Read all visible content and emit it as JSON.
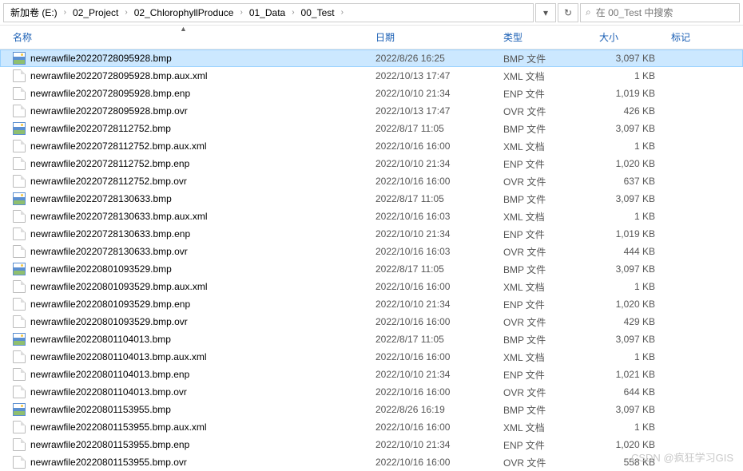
{
  "breadcrumb": [
    "新加卷 (E:)",
    "02_Project",
    "02_ChlorophyllProduce",
    "01_Data",
    "00_Test"
  ],
  "search": {
    "placeholder": "在 00_Test 中搜索"
  },
  "columns": {
    "name": "名称",
    "date": "日期",
    "type": "类型",
    "size": "大小",
    "tag": "标记"
  },
  "files": [
    {
      "name": "newrawfile20220728095928.bmp",
      "date": "2022/8/26 16:25",
      "type": "BMP 文件",
      "size": "3,097 KB",
      "icon": "bmp",
      "selected": true
    },
    {
      "name": "newrawfile20220728095928.bmp.aux.xml",
      "date": "2022/10/13 17:47",
      "type": "XML 文档",
      "size": "1 KB",
      "icon": "generic"
    },
    {
      "name": "newrawfile20220728095928.bmp.enp",
      "date": "2022/10/10 21:34",
      "type": "ENP 文件",
      "size": "1,019 KB",
      "icon": "generic"
    },
    {
      "name": "newrawfile20220728095928.bmp.ovr",
      "date": "2022/10/13 17:47",
      "type": "OVR 文件",
      "size": "426 KB",
      "icon": "generic"
    },
    {
      "name": "newrawfile20220728112752.bmp",
      "date": "2022/8/17 11:05",
      "type": "BMP 文件",
      "size": "3,097 KB",
      "icon": "bmp"
    },
    {
      "name": "newrawfile20220728112752.bmp.aux.xml",
      "date": "2022/10/16 16:00",
      "type": "XML 文档",
      "size": "1 KB",
      "icon": "generic"
    },
    {
      "name": "newrawfile20220728112752.bmp.enp",
      "date": "2022/10/10 21:34",
      "type": "ENP 文件",
      "size": "1,020 KB",
      "icon": "generic"
    },
    {
      "name": "newrawfile20220728112752.bmp.ovr",
      "date": "2022/10/16 16:00",
      "type": "OVR 文件",
      "size": "637 KB",
      "icon": "generic"
    },
    {
      "name": "newrawfile20220728130633.bmp",
      "date": "2022/8/17 11:05",
      "type": "BMP 文件",
      "size": "3,097 KB",
      "icon": "bmp"
    },
    {
      "name": "newrawfile20220728130633.bmp.aux.xml",
      "date": "2022/10/16 16:03",
      "type": "XML 文档",
      "size": "1 KB",
      "icon": "generic"
    },
    {
      "name": "newrawfile20220728130633.bmp.enp",
      "date": "2022/10/10 21:34",
      "type": "ENP 文件",
      "size": "1,019 KB",
      "icon": "generic"
    },
    {
      "name": "newrawfile20220728130633.bmp.ovr",
      "date": "2022/10/16 16:03",
      "type": "OVR 文件",
      "size": "444 KB",
      "icon": "generic"
    },
    {
      "name": "newrawfile20220801093529.bmp",
      "date": "2022/8/17 11:05",
      "type": "BMP 文件",
      "size": "3,097 KB",
      "icon": "bmp"
    },
    {
      "name": "newrawfile20220801093529.bmp.aux.xml",
      "date": "2022/10/16 16:00",
      "type": "XML 文档",
      "size": "1 KB",
      "icon": "generic"
    },
    {
      "name": "newrawfile20220801093529.bmp.enp",
      "date": "2022/10/10 21:34",
      "type": "ENP 文件",
      "size": "1,020 KB",
      "icon": "generic"
    },
    {
      "name": "newrawfile20220801093529.bmp.ovr",
      "date": "2022/10/16 16:00",
      "type": "OVR 文件",
      "size": "429 KB",
      "icon": "generic"
    },
    {
      "name": "newrawfile20220801104013.bmp",
      "date": "2022/8/17 11:05",
      "type": "BMP 文件",
      "size": "3,097 KB",
      "icon": "bmp"
    },
    {
      "name": "newrawfile20220801104013.bmp.aux.xml",
      "date": "2022/10/16 16:00",
      "type": "XML 文档",
      "size": "1 KB",
      "icon": "generic"
    },
    {
      "name": "newrawfile20220801104013.bmp.enp",
      "date": "2022/10/10 21:34",
      "type": "ENP 文件",
      "size": "1,021 KB",
      "icon": "generic"
    },
    {
      "name": "newrawfile20220801104013.bmp.ovr",
      "date": "2022/10/16 16:00",
      "type": "OVR 文件",
      "size": "644 KB",
      "icon": "generic"
    },
    {
      "name": "newrawfile20220801153955.bmp",
      "date": "2022/8/26 16:19",
      "type": "BMP 文件",
      "size": "3,097 KB",
      "icon": "bmp"
    },
    {
      "name": "newrawfile20220801153955.bmp.aux.xml",
      "date": "2022/10/16 16:00",
      "type": "XML 文档",
      "size": "1 KB",
      "icon": "generic"
    },
    {
      "name": "newrawfile20220801153955.bmp.enp",
      "date": "2022/10/10 21:34",
      "type": "ENP 文件",
      "size": "1,020 KB",
      "icon": "generic"
    },
    {
      "name": "newrawfile20220801153955.bmp.ovr",
      "date": "2022/10/16 16:00",
      "type": "OVR 文件",
      "size": "558 KB",
      "icon": "generic"
    }
  ],
  "watermark": "CSDN @疯狂学习GIS"
}
